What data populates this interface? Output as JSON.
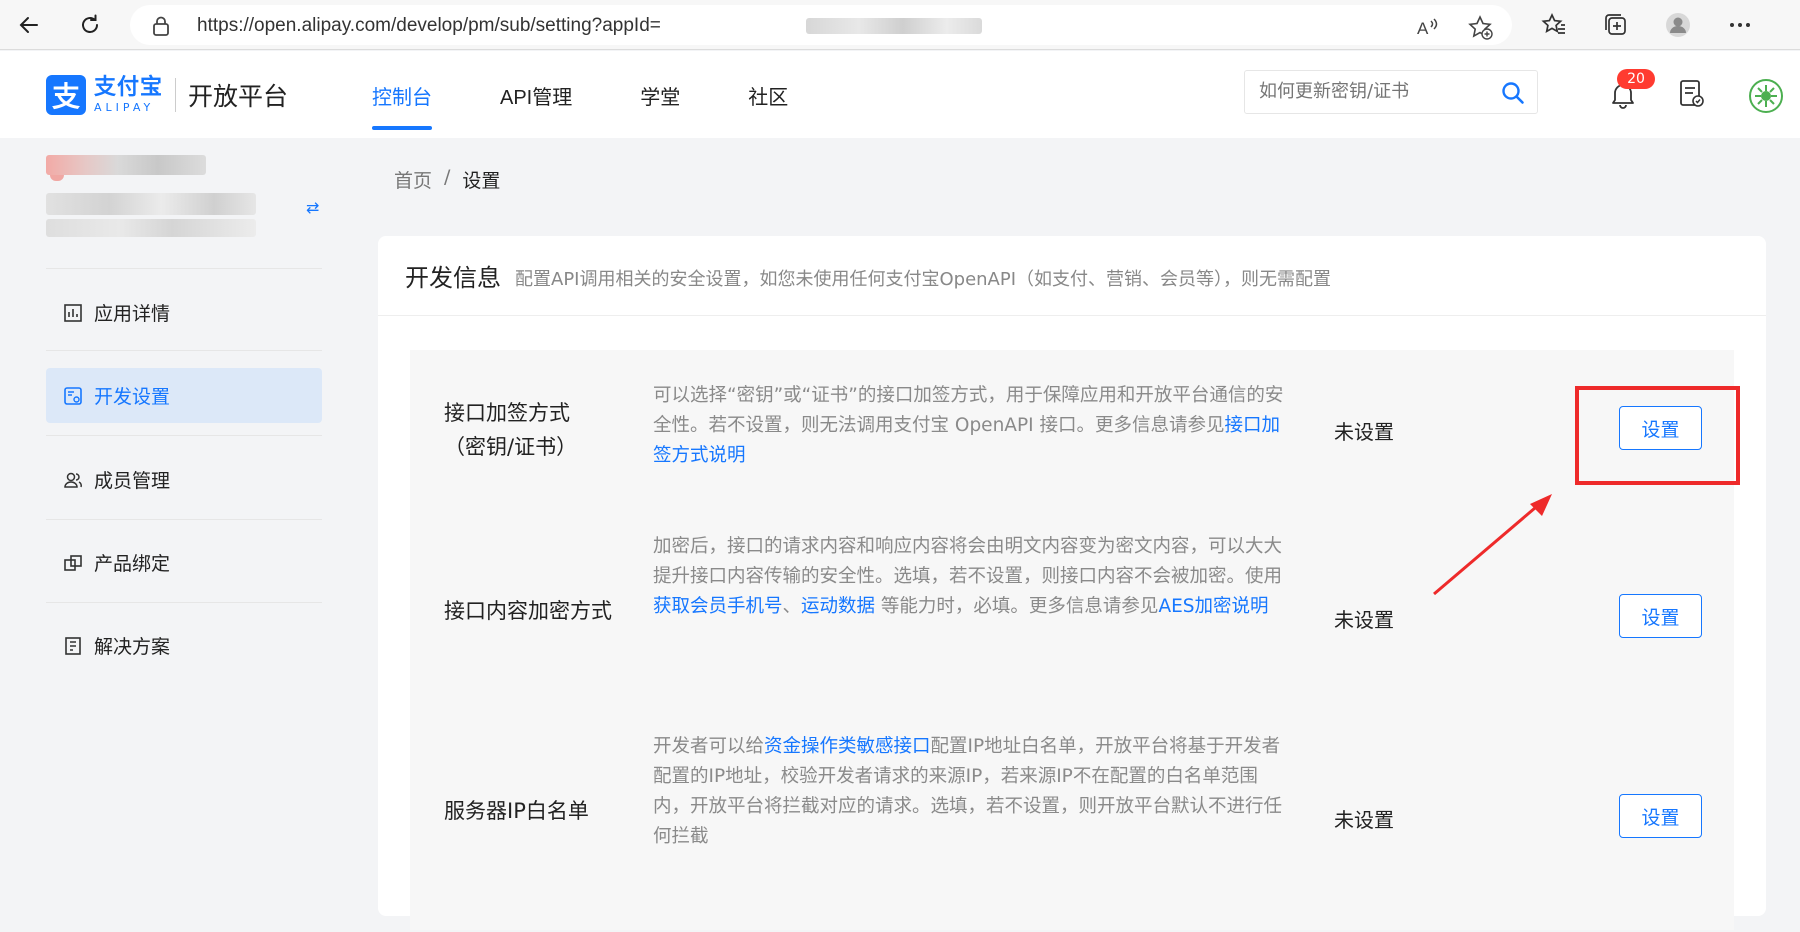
{
  "browser": {
    "url": "https://open.alipay.com/develop/pm/sub/setting?appId=",
    "icons": [
      "back-icon",
      "refresh-icon",
      "lock-icon",
      "read-aloud-icon",
      "add-favorite-icon",
      "favorites-icon",
      "collections-icon",
      "profile-icon",
      "more-icon"
    ]
  },
  "header": {
    "logo_mark": "支",
    "logo_cn": "支付宝",
    "logo_en": "ALIPAY",
    "platform": "开放平台",
    "nav": [
      "控制台",
      "API管理",
      "学堂",
      "社区"
    ],
    "active_nav": "控制台",
    "search_placeholder": "如何更新密钥/证书",
    "notification_count": "20"
  },
  "sidebar": {
    "switch_symbol": "⇄",
    "items": [
      {
        "label": "应用详情",
        "icon": "chart-icon"
      },
      {
        "label": "开发设置",
        "icon": "dev-settings-icon",
        "active": true
      },
      {
        "label": "成员管理",
        "icon": "members-icon"
      },
      {
        "label": "产品绑定",
        "icon": "product-bind-icon"
      },
      {
        "label": "解决方案",
        "icon": "solution-icon"
      }
    ]
  },
  "breadcrumb": {
    "home": "首页",
    "separator": "/",
    "current": "设置"
  },
  "card": {
    "title": "开发信息",
    "description": "配置API调用相关的安全设置，如您未使用任何支付宝OpenAPI（如支付、营销、会员等），则无需配置"
  },
  "rows": [
    {
      "name_line1": "接口加签方式",
      "name_line2": "（密钥/证书）",
      "desc_parts": [
        {
          "text": "可以选择“密钥”或“证书”的接口加签方式，用于保障应用和开放平台通信的安全性。若不设置，则无法调用支付宝 OpenAPI 接口。更多信息请参见",
          "link": false
        },
        {
          "text": "接口加签方式说明",
          "link": true
        }
      ],
      "status": "未设置",
      "button": "设置"
    },
    {
      "name_line1": "接口内容加密方式",
      "desc_parts": [
        {
          "text": "加密后，接口的请求内容和响应内容将会由明文内容变为密文内容，可以大大提升接口内容传输的安全性。选填，若不设置，则接口内容不会被加密。使用 ",
          "link": false
        },
        {
          "text": "获取会员手机号",
          "link": true
        },
        {
          "text": "、",
          "link": false
        },
        {
          "text": "运动数据",
          "link": true
        },
        {
          "text": " 等能力时，必填。更多信息请参见",
          "link": false
        },
        {
          "text": "AES加密说明",
          "link": true
        }
      ],
      "status": "未设置",
      "button": "设置"
    },
    {
      "name_line1": "服务器IP白名单",
      "desc_parts": [
        {
          "text": "开发者可以给",
          "link": false
        },
        {
          "text": "资金操作类敏感接口",
          "link": true
        },
        {
          "text": "配置IP地址白名单，开放平台将基于开发者配置的IP地址，校验开发者请求的来源IP，若来源IP不在配置的白名单范围内，开放平台将拦截对应的请求。选填，若不设置，则开放平台默认不进行任何拦截",
          "link": false
        }
      ],
      "status": "未设置",
      "button": "设置"
    }
  ],
  "colors": {
    "brand": "#1677ff",
    "annotation": "#ee2a2a",
    "badge": "#ff3b30"
  }
}
